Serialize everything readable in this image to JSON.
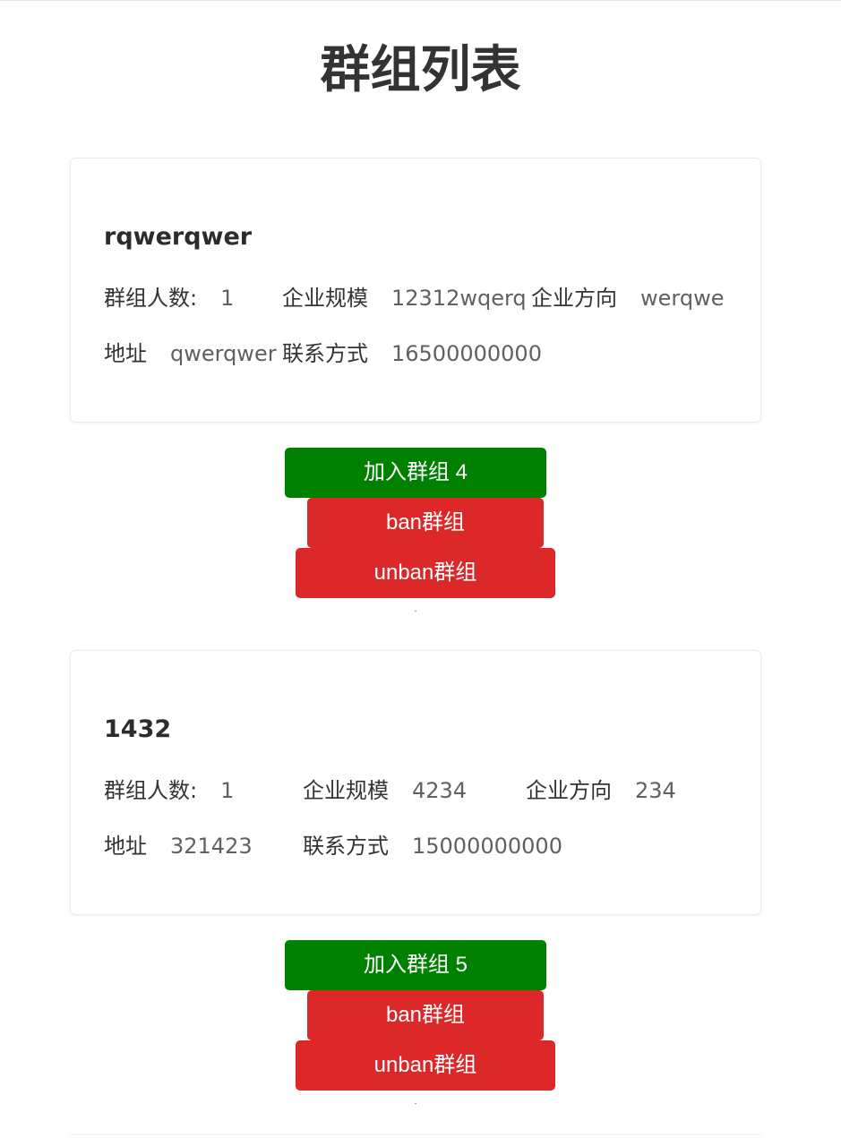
{
  "page": {
    "title": "群组列表"
  },
  "groups": [
    {
      "name": "rqwerqwer",
      "members_label": "群组人数:",
      "members_value": "1",
      "scale_label": "企业规模",
      "scale_value": "12312wqerq",
      "direction_label": "企业方向",
      "direction_value": "werqwe",
      "address_label": "地址",
      "address_value": "qwerqwer",
      "contact_label": "联系方式",
      "contact_value": "16500000000",
      "join_label": "加入群组 4",
      "ban_label": "ban群组",
      "unban_label": "unban群组"
    },
    {
      "name": "1432",
      "members_label": "群组人数:",
      "members_value": "1",
      "scale_label": "企业规模",
      "scale_value": "4234",
      "direction_label": "企业方向",
      "direction_value": "234",
      "address_label": "地址",
      "address_value": "321423",
      "contact_label": "联系方式",
      "contact_value": "15000000000",
      "join_label": "加入群组 5",
      "ban_label": "ban群组",
      "unban_label": "unban群组"
    }
  ],
  "colors": {
    "join_button": "#008000",
    "ban_button": "#dc2828",
    "text_primary": "#333333",
    "text_value": "#606060"
  }
}
